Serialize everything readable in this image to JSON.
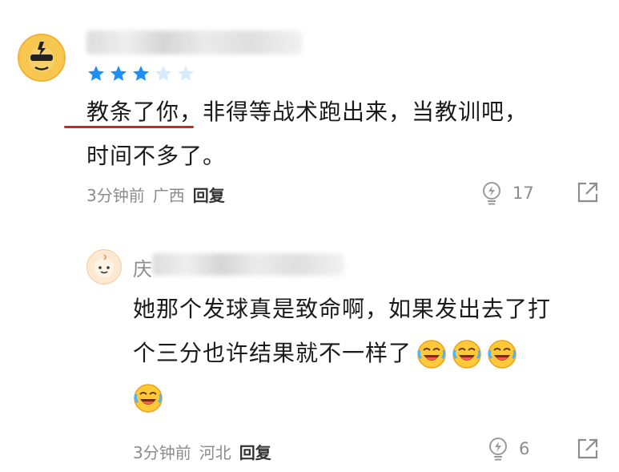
{
  "comments": [
    {
      "username": "",
      "rating": 3,
      "rating_max": 5,
      "text_line1_highlight": "教条了你",
      "text_line1_rest": "，非得等战术跑出来，当教训吧，",
      "text_line2": "时间不多了。",
      "time": "3分钟前",
      "location": "广西",
      "reply_label": "回复",
      "likes": "17"
    },
    {
      "username_visible": "庆",
      "text_line1": "她那个发球真是致命啊，如果发出去了打",
      "text_line2": "个三分也许结果就不一样了",
      "emojis": [
        "laughing-crying-emoji",
        "laughing-crying-emoji",
        "laughing-crying-emoji",
        "laughing-crying-emoji"
      ],
      "time": "3分钟前",
      "location": "河北",
      "reply_label": "回复",
      "likes": "6"
    }
  ],
  "colors": {
    "star_filled": "#1e8ff5",
    "star_empty": "#d6ebfd",
    "highlight_underline": "#e02020",
    "meta_text": "#8c8c8c"
  }
}
